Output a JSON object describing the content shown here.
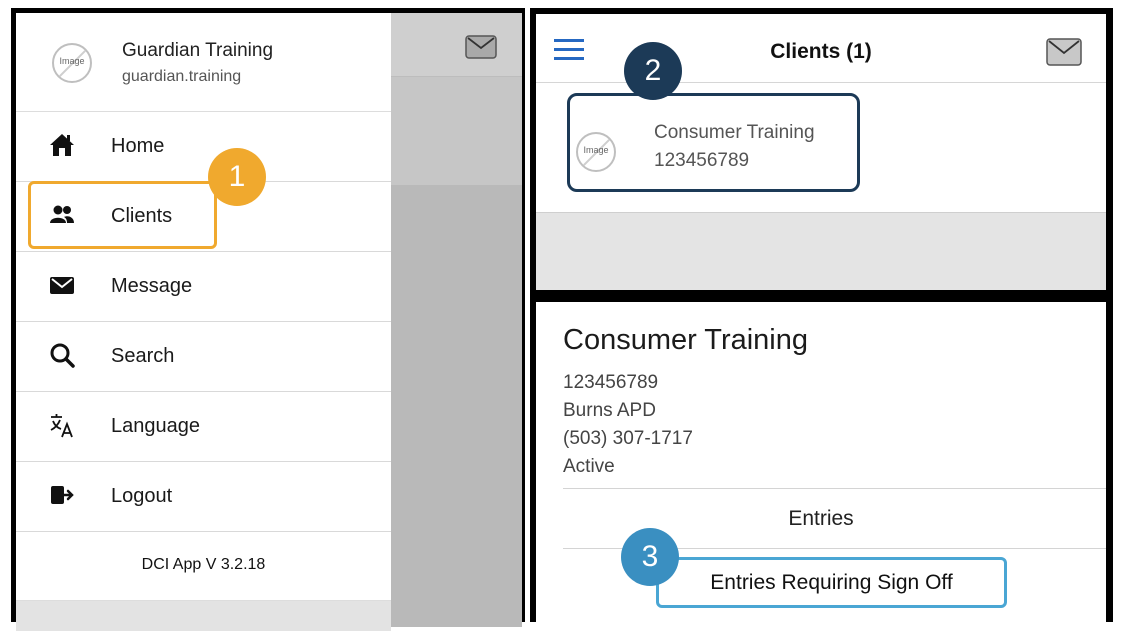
{
  "menu_panel": {
    "account": {
      "avatar_label": "Image",
      "name": "Guardian Training",
      "subtitle": "guardian.training"
    },
    "items": [
      {
        "label": "Home",
        "icon": "home-icon"
      },
      {
        "label": "Clients",
        "icon": "clients-icon"
      },
      {
        "label": "Message",
        "icon": "mail-icon"
      },
      {
        "label": "Search",
        "icon": "search-icon"
      },
      {
        "label": "Language",
        "icon": "language-icon"
      },
      {
        "label": "Logout",
        "icon": "logout-icon"
      }
    ],
    "version": "DCI App V 3.2.18",
    "step_badge": "1"
  },
  "clients_panel": {
    "title": "Clients (1)",
    "step_badge": "2",
    "client": {
      "avatar_label": "Image",
      "name": "Consumer Training",
      "number": "123456789"
    }
  },
  "detail_panel": {
    "step_badge": "3",
    "name": "Consumer Training",
    "number": "123456789",
    "office": "Burns APD",
    "phone": "(503) 307-1717",
    "status": "Active",
    "entries_label": "Entries",
    "signoff_label": "Entries Requiring Sign Off"
  },
  "colors": {
    "step1": "#f0a92e",
    "step2": "#1c3a57",
    "step3": "#4aa6d4",
    "nav_accent": "#2568c2"
  }
}
